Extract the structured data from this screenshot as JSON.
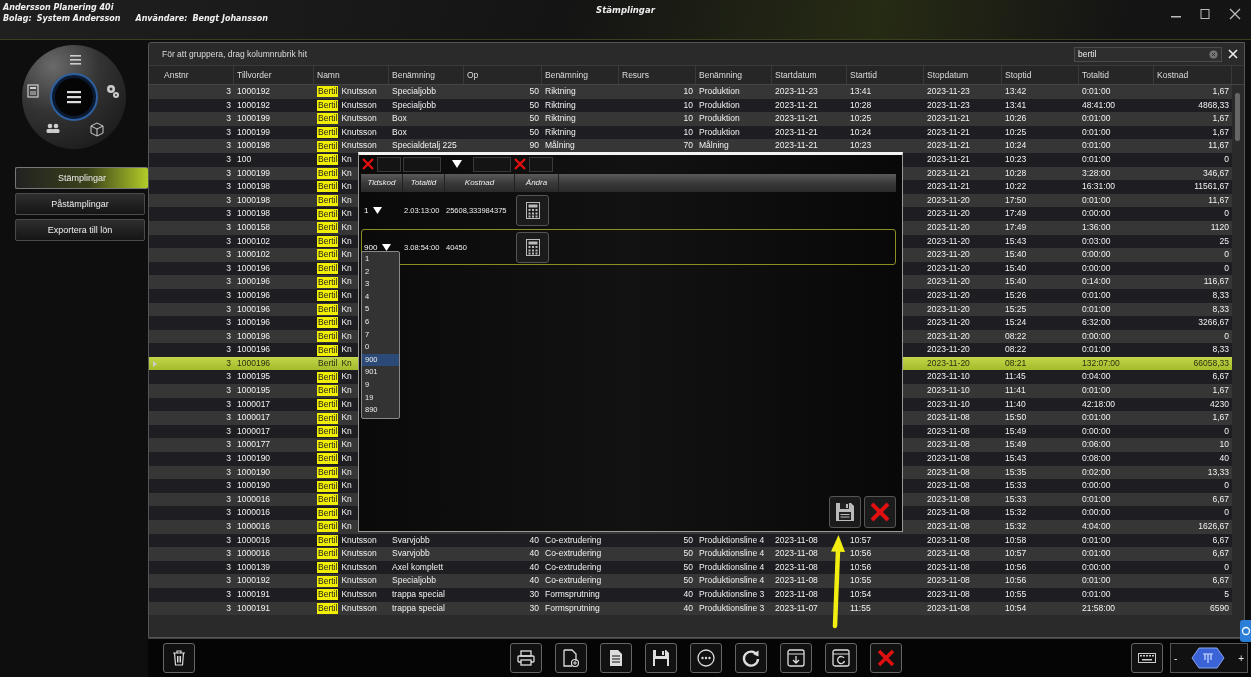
{
  "app": {
    "name": "Andersson Planering 40i",
    "company_label": "Bolag:",
    "company": "System Andersson",
    "user_label": "Användare:",
    "user": "Bengt Johansson",
    "title": "Stämplingar"
  },
  "nav": [
    {
      "label": "Stämplingar",
      "selected": true
    },
    {
      "label": "Påstämplingar",
      "selected": false
    },
    {
      "label": "Exportera till lön",
      "selected": false
    }
  ],
  "grid": {
    "group_hint": "För att gruppera, drag kolumnrubrik hit",
    "search": {
      "value": "bertil"
    },
    "columns": [
      "Anstnr",
      "Tillvorder",
      "Namn",
      "Benämning",
      "Op",
      "Benämning",
      "Resurs",
      "Benämning",
      "Startdatum",
      "Starttid",
      "Stopdatum",
      "Stoptid",
      "Totaltid",
      "Kostnad"
    ],
    "rows": [
      {
        "selected": false,
        "match": "Bertil",
        "cells": [
          "3",
          "1000192",
          "Knutsson",
          "Specialjobb",
          "50",
          "Riktning",
          "10",
          "Produktion",
          "2023-11-23",
          "13:41",
          "2023-11-23",
          "13:42",
          "0:01:00",
          "1,67"
        ]
      },
      {
        "selected": false,
        "match": "Bertil",
        "cells": [
          "3",
          "1000192",
          "Knutsson",
          "Specialjobb",
          "50",
          "Riktning",
          "10",
          "Produktion",
          "2023-11-21",
          "10:28",
          "2023-11-23",
          "13:41",
          "48:41:00",
          "4868,33"
        ]
      },
      {
        "selected": false,
        "match": "Bertil",
        "cells": [
          "3",
          "1000199",
          "Knutsson",
          "Box",
          "50",
          "Riktning",
          "10",
          "Produktion",
          "2023-11-21",
          "10:25",
          "2023-11-21",
          "10:26",
          "0:01:00",
          "1,67"
        ]
      },
      {
        "selected": false,
        "match": "Bertil",
        "cells": [
          "3",
          "1000199",
          "Knutsson",
          "Box",
          "50",
          "Riktning",
          "10",
          "Produktion",
          "2023-11-21",
          "10:24",
          "2023-11-21",
          "10:25",
          "0:01:00",
          "1,67"
        ]
      },
      {
        "selected": false,
        "match": "Bertil",
        "cells": [
          "3",
          "1000198",
          "Knutsson",
          "Specialdetalj 225",
          "90",
          "Målning",
          "70",
          "Målning",
          "2023-11-21",
          "10:23",
          "2023-11-21",
          "10:24",
          "0:01:00",
          "11,67"
        ]
      },
      {
        "selected": false,
        "match": "Bertil",
        "cells": [
          "3",
          "100",
          "Kn",
          null,
          null,
          null,
          null,
          null,
          null,
          null,
          "2023-11-21",
          "10:23",
          "0:01:00",
          "0"
        ]
      },
      {
        "selected": false,
        "match": "Bertil",
        "cells": [
          "3",
          "1000199",
          "Kn",
          null,
          null,
          null,
          null,
          null,
          null,
          null,
          "2023-11-21",
          "10:28",
          "3:28:00",
          "346,67"
        ]
      },
      {
        "selected": false,
        "match": "Bertil",
        "cells": [
          "3",
          "1000198",
          "Kn",
          null,
          null,
          null,
          null,
          null,
          null,
          null,
          "2023-11-21",
          "10:22",
          "16:31:00",
          "11561,67"
        ]
      },
      {
        "selected": false,
        "match": "Bertil",
        "cells": [
          "3",
          "1000198",
          "Kn",
          null,
          null,
          null,
          null,
          null,
          null,
          null,
          "2023-11-20",
          "17:50",
          "0:01:00",
          "11,67"
        ]
      },
      {
        "selected": false,
        "match": "Bertil",
        "cells": [
          "3",
          "1000198",
          "Kn",
          null,
          null,
          null,
          null,
          null,
          null,
          null,
          "2023-11-20",
          "17:49",
          "0:00:00",
          "0"
        ]
      },
      {
        "selected": false,
        "match": "Bertil",
        "cells": [
          "3",
          "1000158",
          "Kn",
          null,
          null,
          null,
          null,
          null,
          null,
          null,
          "2023-11-20",
          "17:49",
          "1:36:00",
          "1120"
        ]
      },
      {
        "selected": false,
        "match": "Bertil",
        "cells": [
          "3",
          "1000102",
          "Kn",
          null,
          null,
          null,
          null,
          null,
          null,
          null,
          "2023-11-20",
          "15:43",
          "0:03:00",
          "25"
        ]
      },
      {
        "selected": false,
        "match": "Bertil",
        "cells": [
          "3",
          "1000102",
          "Kn",
          null,
          null,
          null,
          null,
          null,
          null,
          null,
          "2023-11-20",
          "15:40",
          "0:00:00",
          "0"
        ]
      },
      {
        "selected": false,
        "match": "Bertil",
        "cells": [
          "3",
          "1000196",
          "Kn",
          null,
          null,
          null,
          null,
          null,
          null,
          null,
          "2023-11-20",
          "15:40",
          "0:00:00",
          "0"
        ]
      },
      {
        "selected": false,
        "match": "Bertil",
        "cells": [
          "3",
          "1000196",
          "Kn",
          null,
          null,
          null,
          null,
          null,
          null,
          null,
          "2023-11-20",
          "15:40",
          "0:14:00",
          "116,67"
        ]
      },
      {
        "selected": false,
        "match": "Bertil",
        "cells": [
          "3",
          "1000196",
          "Kn",
          null,
          null,
          null,
          null,
          null,
          null,
          null,
          "2023-11-20",
          "15:26",
          "0:01:00",
          "8,33"
        ]
      },
      {
        "selected": false,
        "match": "Bertil",
        "cells": [
          "3",
          "1000196",
          "Kn",
          null,
          null,
          null,
          null,
          null,
          null,
          null,
          "2023-11-20",
          "15:25",
          "0:01:00",
          "8,33"
        ]
      },
      {
        "selected": false,
        "match": "Bertil",
        "cells": [
          "3",
          "1000196",
          "Kn",
          null,
          null,
          null,
          null,
          null,
          null,
          null,
          "2023-11-20",
          "15:24",
          "6:32:00",
          "3266,67"
        ]
      },
      {
        "selected": false,
        "match": "Bertil",
        "cells": [
          "3",
          "1000196",
          "Kn",
          null,
          null,
          null,
          null,
          null,
          null,
          null,
          "2023-11-20",
          "08:22",
          "0:00:00",
          "0"
        ]
      },
      {
        "selected": false,
        "match": "Bertil",
        "cells": [
          "3",
          "1000196",
          "Kn",
          null,
          null,
          null,
          null,
          null,
          null,
          null,
          "2023-11-20",
          "08:22",
          "0:01:00",
          "8,33"
        ]
      },
      {
        "selected": true,
        "match": "Bertil",
        "cells": [
          "3",
          "1000196",
          "Kn",
          null,
          null,
          null,
          null,
          null,
          null,
          null,
          "2023-11-20",
          "08:21",
          "132:07:00",
          "66058,33"
        ]
      },
      {
        "selected": false,
        "match": "Bertil",
        "cells": [
          "3",
          "1000195",
          "Kn",
          null,
          null,
          null,
          null,
          null,
          null,
          null,
          "2023-11-10",
          "11:45",
          "0:04:00",
          "6,67"
        ]
      },
      {
        "selected": false,
        "match": "Bertil",
        "cells": [
          "3",
          "1000195",
          "Kn",
          null,
          null,
          null,
          null,
          null,
          null,
          null,
          "2023-11-10",
          "11:41",
          "0:01:00",
          "1,67"
        ]
      },
      {
        "selected": false,
        "match": "Bertil",
        "cells": [
          "3",
          "1000017",
          "Kn",
          null,
          null,
          null,
          null,
          null,
          null,
          null,
          "2023-11-10",
          "11:40",
          "42:18:00",
          "4230"
        ]
      },
      {
        "selected": false,
        "match": "Bertil",
        "cells": [
          "3",
          "1000017",
          "Kn",
          null,
          null,
          null,
          null,
          null,
          null,
          null,
          "2023-11-08",
          "15:50",
          "0:01:00",
          "1,67"
        ]
      },
      {
        "selected": false,
        "match": "Bertil",
        "cells": [
          "3",
          "1000017",
          "Kn",
          null,
          null,
          null,
          null,
          null,
          null,
          null,
          "2023-11-08",
          "15:49",
          "0:00:00",
          "0"
        ]
      },
      {
        "selected": false,
        "match": "Bertil",
        "cells": [
          "3",
          "1000177",
          "Kn",
          null,
          null,
          null,
          null,
          null,
          null,
          null,
          "2023-11-08",
          "15:49",
          "0:06:00",
          "10"
        ]
      },
      {
        "selected": false,
        "match": "Bertil",
        "cells": [
          "3",
          "1000190",
          "Kn",
          null,
          null,
          null,
          null,
          null,
          null,
          null,
          "2023-11-08",
          "15:43",
          "0:08:00",
          "40"
        ]
      },
      {
        "selected": false,
        "match": "Bertil",
        "cells": [
          "3",
          "1000190",
          "Kn",
          null,
          null,
          null,
          null,
          null,
          null,
          null,
          "2023-11-08",
          "15:35",
          "0:02:00",
          "13,33"
        ]
      },
      {
        "selected": false,
        "match": "Bertil",
        "cells": [
          "3",
          "1000190",
          "Kn",
          null,
          null,
          null,
          null,
          null,
          null,
          null,
          "2023-11-08",
          "15:33",
          "0:00:00",
          "0"
        ]
      },
      {
        "selected": false,
        "match": "Bertil",
        "cells": [
          "3",
          "1000016",
          "Kn",
          null,
          null,
          null,
          null,
          null,
          null,
          null,
          "2023-11-08",
          "15:33",
          "0:01:00",
          "6,67"
        ]
      },
      {
        "selected": false,
        "match": "Bertil",
        "cells": [
          "3",
          "1000016",
          "Kn",
          null,
          null,
          null,
          null,
          null,
          null,
          null,
          "2023-11-08",
          "15:32",
          "0:00:00",
          "0"
        ]
      },
      {
        "selected": false,
        "match": "Bertil",
        "cells": [
          "3",
          "1000016",
          "Kn",
          null,
          null,
          null,
          null,
          null,
          null,
          null,
          "2023-11-08",
          "15:32",
          "4:04:00",
          "1626,67"
        ]
      },
      {
        "selected": false,
        "match": "Bertil",
        "cells": [
          "3",
          "1000016",
          "Knutsson",
          "Svarvjobb",
          "40",
          "Co-extrudering",
          "50",
          "Produktionsline 4",
          "2023-11-08",
          "10:57",
          "2023-11-08",
          "10:58",
          "0:01:00",
          "6,67"
        ]
      },
      {
        "selected": false,
        "match": "Bertil",
        "cells": [
          "3",
          "1000016",
          "Knutsson",
          "Svarvjobb",
          "40",
          "Co-extrudering",
          "50",
          "Produktionsline 4",
          "2023-11-08",
          "10:56",
          "2023-11-08",
          "10:57",
          "0:01:00",
          "6,67"
        ]
      },
      {
        "selected": false,
        "match": "Bertil",
        "cells": [
          "3",
          "1000139",
          "Knutsson",
          "Axel komplett",
          "40",
          "Co-extrudering",
          "50",
          "Produktionsline 4",
          "2023-11-08",
          "10:56",
          "2023-11-08",
          "10:56",
          "0:00:00",
          "0"
        ]
      },
      {
        "selected": false,
        "match": "Bertil",
        "cells": [
          "3",
          "1000192",
          "Knutsson",
          "Specialjobb",
          "40",
          "Co-extrudering",
          "50",
          "Produktionsline 4",
          "2023-11-08",
          "10:55",
          "2023-11-08",
          "10:56",
          "0:01:00",
          "6,67"
        ]
      },
      {
        "selected": false,
        "match": "Bertil",
        "cells": [
          "3",
          "1000191",
          "Knutsson",
          "trappa special",
          "30",
          "Formsprutning",
          "40",
          "Produktionsline 3",
          "2023-11-08",
          "10:54",
          "2023-11-08",
          "10:55",
          "0:01:00",
          "5"
        ]
      },
      {
        "selected": false,
        "match": "Bertil",
        "cells": [
          "3",
          "1000191",
          "Knutsson",
          "trappa special",
          "30",
          "Formsprutning",
          "40",
          "Produktionsline 3",
          "2023-11-07",
          "11:55",
          "2023-11-08",
          "10:54",
          "21:58:00",
          "6590"
        ]
      }
    ]
  },
  "dialog": {
    "columns": [
      "Tidskod",
      "Totaltid",
      "Kostnad",
      "Ändra"
    ],
    "rows": [
      {
        "code": "1",
        "total": "2.03:13:00",
        "cost": "25608,333984375",
        "selected": false
      },
      {
        "code": "900",
        "total": "3.08:54:00",
        "cost": "40450",
        "selected": true
      }
    ],
    "code_options": [
      {
        "label": "1",
        "selected": false
      },
      {
        "label": "2",
        "selected": false
      },
      {
        "label": "3",
        "selected": false
      },
      {
        "label": "4",
        "selected": false
      },
      {
        "label": "5",
        "selected": false
      },
      {
        "label": "6",
        "selected": false
      },
      {
        "label": "7",
        "selected": false
      },
      {
        "label": "0",
        "selected": false
      },
      {
        "label": "900",
        "selected": true
      },
      {
        "label": "901",
        "selected": false
      },
      {
        "label": "9",
        "selected": false
      },
      {
        "label": "19",
        "selected": false
      },
      {
        "label": "890",
        "selected": false
      }
    ]
  },
  "zoom": {
    "minus": "-",
    "plus": "+"
  }
}
